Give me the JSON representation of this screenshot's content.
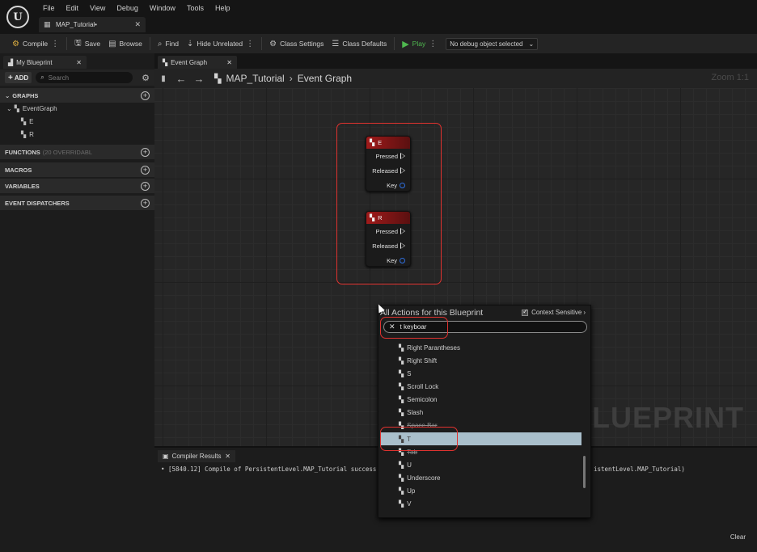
{
  "app": {
    "logo_text": "U",
    "menu": [
      "File",
      "Edit",
      "View",
      "Debug",
      "Window",
      "Tools",
      "Help"
    ],
    "document_tab": "MAP_Tutorial•"
  },
  "toolbar": {
    "compile": "Compile",
    "save": "Save",
    "browse": "Browse",
    "find": "Find",
    "hide_unrelated": "Hide Unrelated",
    "class_settings": "Class Settings",
    "class_defaults": "Class Defaults",
    "play": "Play",
    "debug_object": "No debug object selected"
  },
  "my_blueprint": {
    "tab": "My Blueprint",
    "add": "ADD",
    "search_placeholder": "Search",
    "sections": {
      "graphs": "GRAPHS",
      "functions": "FUNCTIONS",
      "functions_sub": "(20 OVERRIDABL",
      "macros": "MACROS",
      "variables": "VARIABLES",
      "event_dispatchers": "EVENT DISPATCHERS"
    },
    "tree": {
      "event_graph": "EventGraph",
      "items": [
        "E",
        "R"
      ]
    }
  },
  "graph": {
    "tab": "Event Graph",
    "breadcrumb": [
      "MAP_Tutorial",
      "Event Graph"
    ],
    "zoom": "Zoom 1:1",
    "watermark": "BLUEPRINT",
    "nodes": [
      {
        "title": "E",
        "pins": [
          "Pressed",
          "Released",
          "Key"
        ]
      },
      {
        "title": "R",
        "pins": [
          "Pressed",
          "Released",
          "Key"
        ]
      }
    ]
  },
  "action_menu": {
    "title": "All Actions for this Blueprint",
    "context_sensitive": "Context Sensitive",
    "search_value": "t keyboar",
    "items": [
      "Right Parantheses",
      "Right Shift",
      "S",
      "Scroll Lock",
      "Semicolon",
      "Slash",
      "Space Bar",
      "T",
      "Tab",
      "U",
      "Underscore",
      "Up",
      "V"
    ],
    "selected": "T"
  },
  "compiler": {
    "tab": "Compiler Results",
    "message": "• [5840.12] Compile of PersistentLevel.MAP_Tutorial success",
    "message_tail": "istentLevel.MAP_Tutorial)",
    "clear": "Clear"
  },
  "colors": {
    "annotation": "#e0322f",
    "selection": "#a9bfcb",
    "event_node_header": "#a01a1a",
    "play_green": "#4fb84f"
  }
}
